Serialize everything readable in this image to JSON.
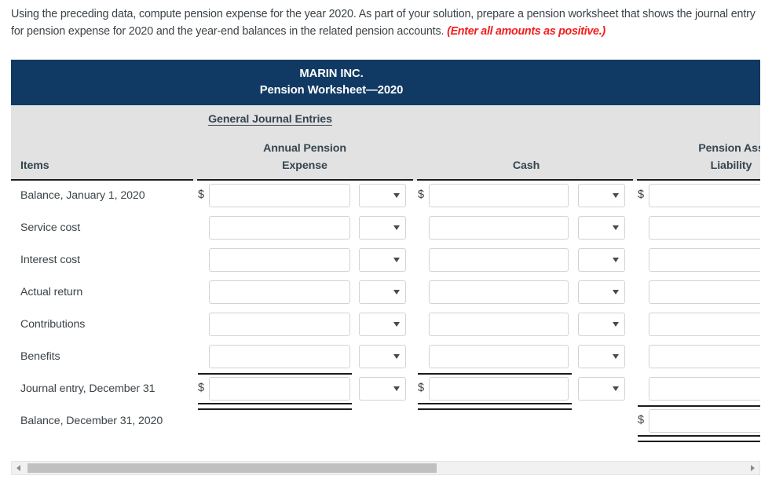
{
  "prompt": {
    "text": "Using the preceding data, compute pension expense for the year 2020. As part of your solution, prepare a pension worksheet that shows the journal entry for pension expense for 2020 and the year-end balances in the related pension accounts. ",
    "emphasis": "(Enter all amounts as positive.)"
  },
  "worksheet": {
    "company": "MARIN INC.",
    "subtitle": "Pension Worksheet—2020",
    "group_header": "General Journal Entries",
    "columns": {
      "items": "Items",
      "annual_pension_expense_line1": "Annual Pension",
      "annual_pension_expense_line2": "Expense",
      "cash": "Cash",
      "pension_asset_line1": "Pension Ass",
      "pension_asset_line2": "Liability"
    },
    "currency_symbol": "$",
    "dropdown_caret": "chevron-down-icon",
    "rows": [
      {
        "label": "Balance, January 1, 2020",
        "c1": {
          "show_dollar": true,
          "value": "",
          "placeholder": "",
          "has_dropdown": true,
          "dropdown_value": ""
        },
        "c2": {
          "show_dollar": true,
          "value": "",
          "placeholder": "",
          "has_dropdown": true,
          "dropdown_value": ""
        },
        "c3": {
          "show_dollar": true,
          "value": "",
          "placeholder": "",
          "has_dropdown": false
        }
      },
      {
        "label": "Service cost",
        "c1": {
          "show_dollar": false,
          "value": "",
          "placeholder": "",
          "has_dropdown": true,
          "dropdown_value": ""
        },
        "c2": {
          "show_dollar": false,
          "value": "",
          "placeholder": "",
          "has_dropdown": true,
          "dropdown_value": ""
        },
        "c3": {
          "show_dollar": false,
          "value": "",
          "placeholder": "",
          "has_dropdown": false
        }
      },
      {
        "label": "Interest cost",
        "c1": {
          "show_dollar": false,
          "value": "",
          "placeholder": "",
          "has_dropdown": true,
          "dropdown_value": ""
        },
        "c2": {
          "show_dollar": false,
          "value": "",
          "placeholder": "",
          "has_dropdown": true,
          "dropdown_value": ""
        },
        "c3": {
          "show_dollar": false,
          "value": "",
          "placeholder": "",
          "has_dropdown": false
        }
      },
      {
        "label": "Actual return",
        "c1": {
          "show_dollar": false,
          "value": "",
          "placeholder": "",
          "has_dropdown": true,
          "dropdown_value": ""
        },
        "c2": {
          "show_dollar": false,
          "value": "",
          "placeholder": "",
          "has_dropdown": true,
          "dropdown_value": ""
        },
        "c3": {
          "show_dollar": false,
          "value": "",
          "placeholder": "",
          "has_dropdown": false
        }
      },
      {
        "label": "Contributions",
        "c1": {
          "show_dollar": false,
          "value": "",
          "placeholder": "",
          "has_dropdown": true,
          "dropdown_value": ""
        },
        "c2": {
          "show_dollar": false,
          "value": "",
          "placeholder": "",
          "has_dropdown": true,
          "dropdown_value": ""
        },
        "c3": {
          "show_dollar": false,
          "value": "",
          "placeholder": "",
          "has_dropdown": false
        }
      },
      {
        "label": "Benefits",
        "c1": {
          "show_dollar": false,
          "value": "",
          "placeholder": "",
          "has_dropdown": true,
          "dropdown_value": ""
        },
        "c2": {
          "show_dollar": false,
          "value": "",
          "placeholder": "",
          "has_dropdown": true,
          "dropdown_value": ""
        },
        "c3": {
          "show_dollar": false,
          "value": "",
          "placeholder": "",
          "has_dropdown": false
        }
      },
      {
        "label": "Journal entry, December 31",
        "c1": {
          "show_dollar": true,
          "value": "",
          "placeholder": "",
          "has_dropdown": true,
          "dropdown_value": ""
        },
        "c2": {
          "show_dollar": true,
          "value": "",
          "placeholder": "",
          "has_dropdown": true,
          "dropdown_value": ""
        },
        "c3": {
          "show_dollar": false,
          "value": "",
          "placeholder": "",
          "has_dropdown": false
        }
      },
      {
        "label": "Balance, December 31, 2020",
        "c1": {
          "show_dollar": false,
          "value": null,
          "has_dropdown": false
        },
        "c2": {
          "show_dollar": false,
          "value": null,
          "has_dropdown": false
        },
        "c3": {
          "show_dollar": true,
          "value": "",
          "placeholder": "",
          "has_dropdown": false
        }
      }
    ]
  },
  "scrollbar": {
    "left_arrow": "triangle-left-icon",
    "right_arrow": "triangle-right-icon",
    "thumb_fraction": 0.57
  },
  "colors": {
    "header_navy": "#103a63",
    "header_gray": "#e2e2e2",
    "text": "#3c4348",
    "emphasis_red": "#f41d1d",
    "rule": "#1c1c1c",
    "input_border": "#d2d3d4",
    "scroll_thumb": "#c0c0c0"
  }
}
